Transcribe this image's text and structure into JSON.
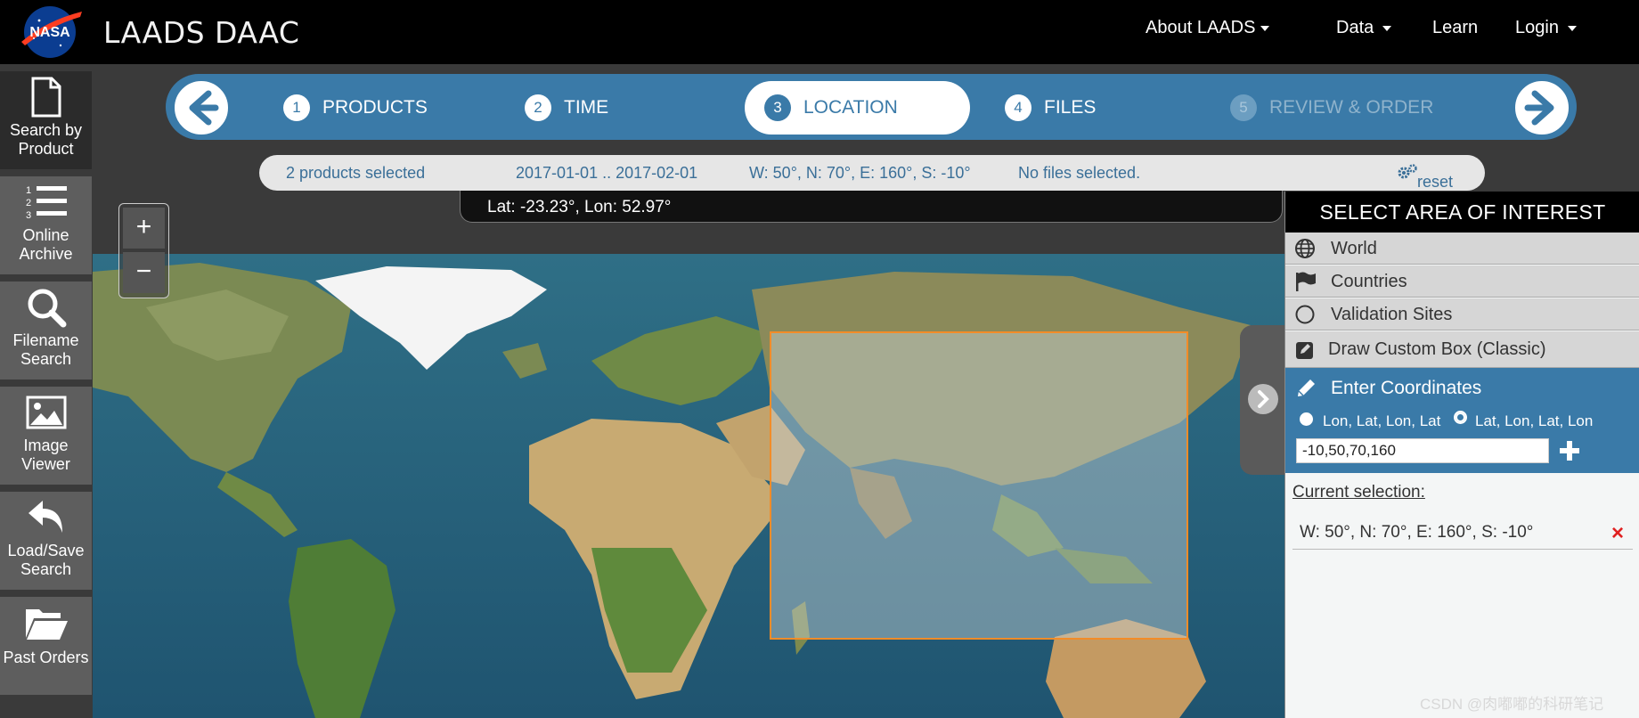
{
  "navbar": {
    "logo_text": "NASA",
    "brand": "LAADS DAAC",
    "links": [
      {
        "label": "About LAADS",
        "has_menu": true
      },
      {
        "label": "Data",
        "has_menu": true
      },
      {
        "label": "Learn",
        "has_menu": false
      },
      {
        "label": "Login",
        "has_menu": true
      }
    ]
  },
  "sidebar": {
    "items": [
      {
        "label_line1": "Search by",
        "label_line2": "Product",
        "icon": "document-icon",
        "active": true
      },
      {
        "label_line1": "Online",
        "label_line2": "Archive",
        "icon": "numbered-list-icon",
        "active": false
      },
      {
        "label_line1": "Filename",
        "label_line2": "Search",
        "icon": "search-icon",
        "active": false
      },
      {
        "label_line1": "Image",
        "label_line2": "Viewer",
        "icon": "image-icon",
        "active": false
      },
      {
        "label_line1": "Load/Save",
        "label_line2": "Search",
        "icon": "undo-arrow-icon",
        "active": false
      },
      {
        "label_line1": "Past Orders",
        "label_line2": "",
        "icon": "folder-open-icon",
        "active": false
      }
    ]
  },
  "wizard": {
    "steps": [
      {
        "num": "1",
        "label": "PRODUCTS",
        "state": "done"
      },
      {
        "num": "2",
        "label": "TIME",
        "state": "done"
      },
      {
        "num": "3",
        "label": "LOCATION",
        "state": "active"
      },
      {
        "num": "4",
        "label": "FILES",
        "state": "next"
      },
      {
        "num": "5",
        "label": "REVIEW & ORDER",
        "state": "disabled"
      }
    ]
  },
  "summary": {
    "products": "2 products selected",
    "dates": "2017-01-01 .. 2017-02-01",
    "bbox": "W: 50°, N: 70°, E: 160°, S: -10°",
    "files": "No files selected.",
    "reset_label": "reset"
  },
  "map": {
    "cursor_readout": "Lat: -23.23°, Lon: 52.97°",
    "zoom_in": "+",
    "zoom_out": "−"
  },
  "panel": {
    "title": "SELECT AREA OF INTEREST",
    "options": [
      {
        "label": "World",
        "icon": "globe-icon"
      },
      {
        "label": "Countries",
        "icon": "flag-icon"
      },
      {
        "label": "Validation Sites",
        "icon": "circle-icon"
      },
      {
        "label": "Draw Custom Box (Classic)",
        "icon": "edit-box-icon"
      }
    ],
    "enter_coords_label": "Enter Coordinates",
    "radio_lon_first": "Lon, Lat, Lon, Lat",
    "radio_lat_first": "Lat, Lon, Lat, Lon",
    "selected_radio": "Lat, Lon, Lat, Lon",
    "coords_value": "-10,50,70,160",
    "current_selection_label": "Current selection:",
    "current_selection_value": "W: 50°, N: 70°, E: 160°, S: -10°",
    "remove_symbol": "×"
  },
  "watermark": "CSDN @肉嘟嘟的科研笔记",
  "colors": {
    "accent_blue": "#3a7aa8",
    "selection_box": "#f28c28",
    "remove_red": "#e02020"
  }
}
